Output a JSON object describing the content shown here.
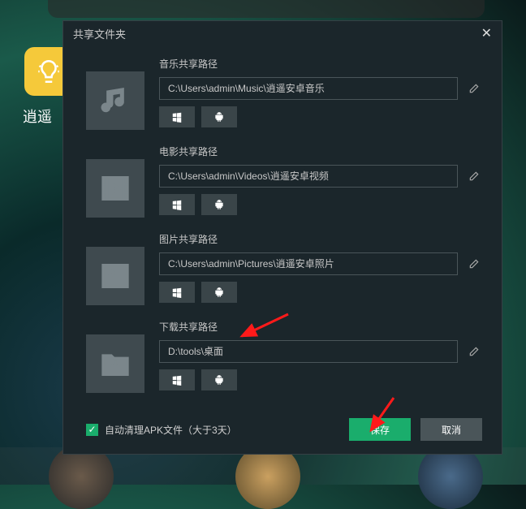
{
  "background": {
    "app_label": "逍遥"
  },
  "dialog": {
    "title": "共享文件夹",
    "sections": {
      "music": {
        "label": "音乐共享路径",
        "path": "C:\\Users\\admin\\Music\\逍遥安卓音乐"
      },
      "video": {
        "label": "电影共享路径",
        "path": "C:\\Users\\admin\\Videos\\逍遥安卓视频"
      },
      "picture": {
        "label": "图片共享路径",
        "path": "C:\\Users\\admin\\Pictures\\逍遥安卓照片"
      },
      "download": {
        "label": "下载共享路径",
        "path": "D:\\tools\\桌面"
      }
    },
    "auto_clean": {
      "checked": true,
      "label": "自动清理APK文件（大于3天）"
    },
    "buttons": {
      "save": "保存",
      "cancel": "取消"
    }
  }
}
